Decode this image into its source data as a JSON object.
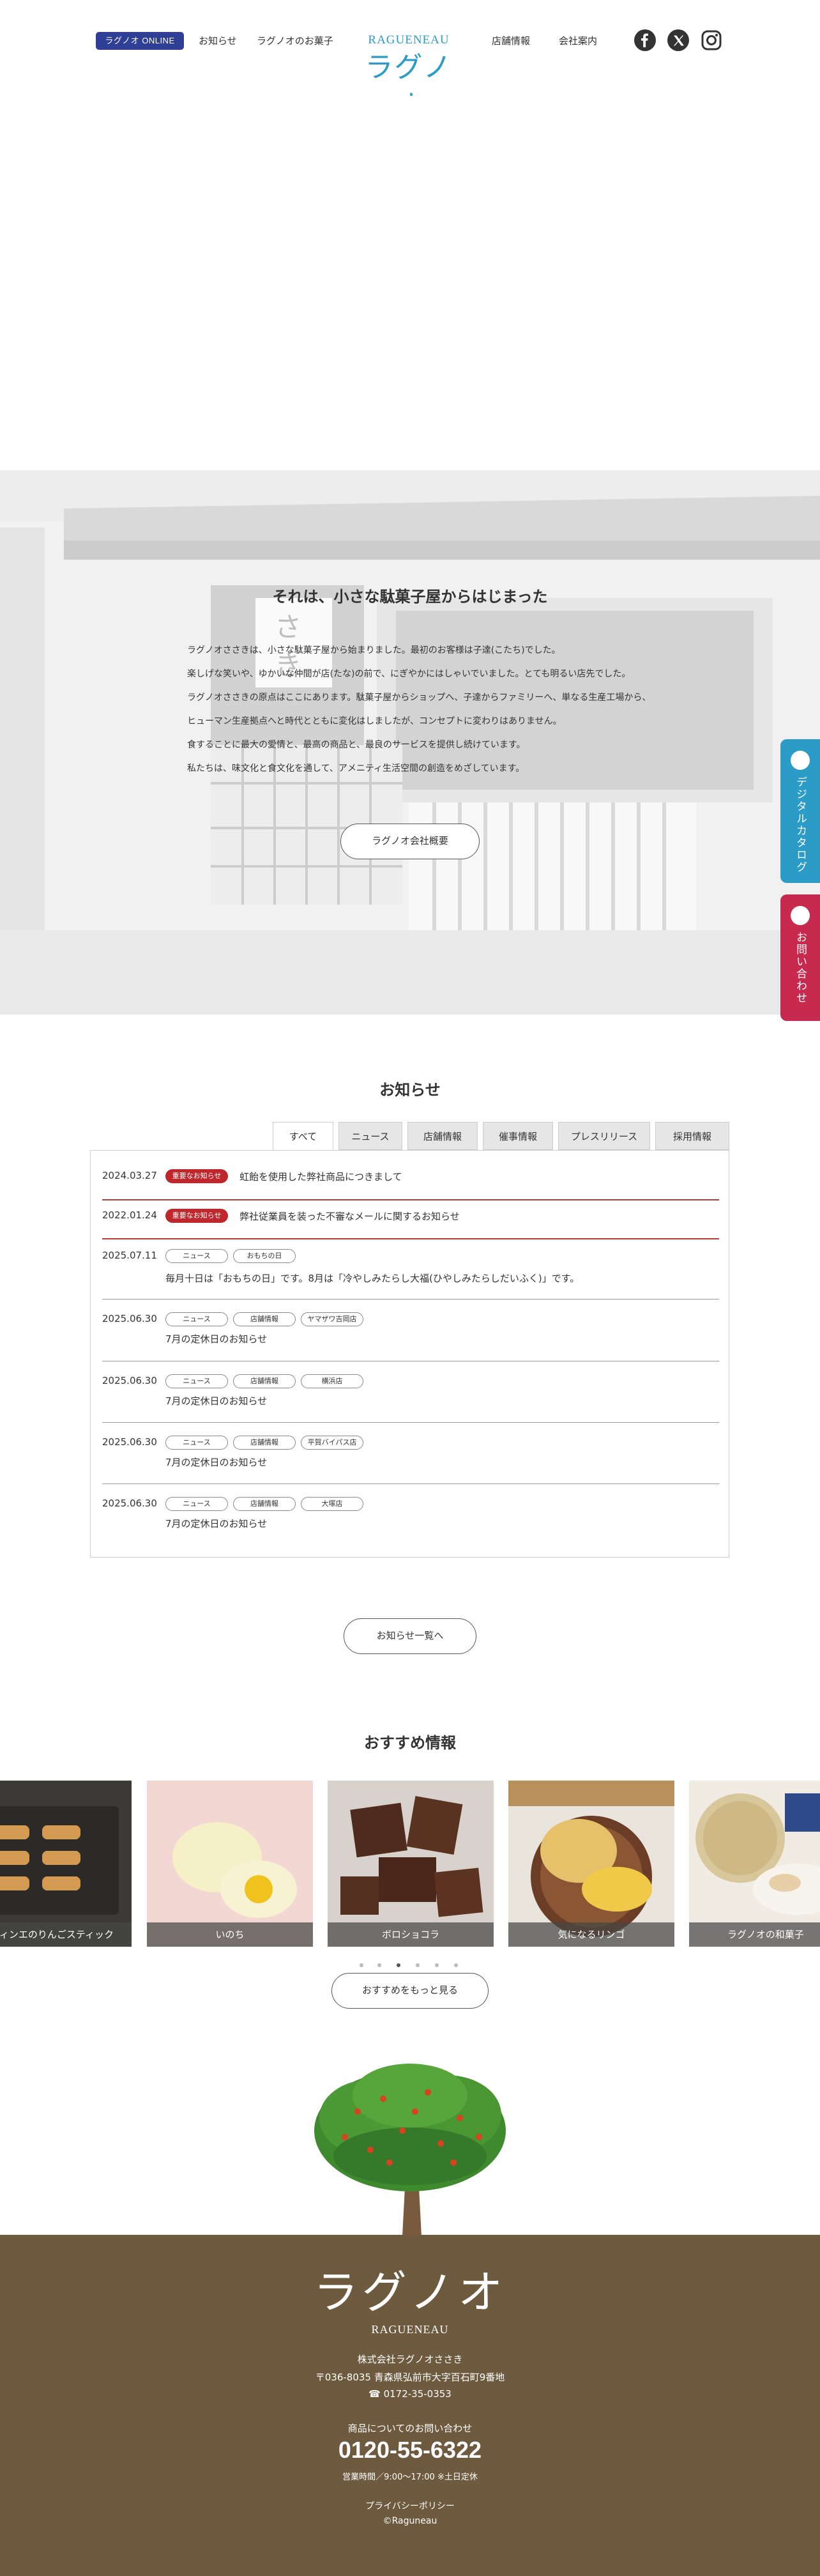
{
  "header": {
    "online_shop": "ラグノオ ONLINE SHOP",
    "nav": [
      "お知らせ",
      "ラグノオのお菓子",
      "店舗情報",
      "会社案内"
    ],
    "logo_en": "RAGUENEAU",
    "logo_jp": "ラグノオ"
  },
  "story": {
    "title": "それは、小さな駄菓子屋からはじまった",
    "paragraphs": [
      "ラグノオささきは、小さな駄菓子屋から始まりました。最初のお客様は子達(こたち)でした。",
      "楽しげな笑いや、ゆかいな仲間が店(たな)の前で、にぎやかにはしゃいでいました。とても明るい店先でした。",
      "ラグノオささきの原点はここにあります。駄菓子屋からショップへ、子達からファミリーへ、単なる生産工場から、",
      "ヒューマン生産拠点へと時代とともに変化はしましたが、コンセプトに変わりはありません。",
      "食することに最大の愛情と、最高の商品と、最良のサービスを提供し続けています。",
      "私たちは、味文化と食文化を通して、アメニティ生活空間の創造をめざしています。"
    ],
    "button": "ラグノオ会社概要"
  },
  "side_tabs": {
    "catalog": "デジタルカタログ",
    "contact": "お問い合わせ"
  },
  "news": {
    "title": "お知らせ",
    "tabs": [
      "すべて",
      "ニュース",
      "店舗情報",
      "催事情報",
      "プレスリリース",
      "採用情報"
    ],
    "items": [
      {
        "date": "2024.03.27",
        "tags": [
          "重要なお知らせ"
        ],
        "title": "虹飴を使用した弊社商品につきまして"
      },
      {
        "date": "2022.01.24",
        "tags": [
          "重要なお知らせ"
        ],
        "title": "弊社従業員を装った不審なメールに関するお知らせ"
      },
      {
        "date": "2025.07.11",
        "tags": [
          "ニュース",
          "おもちの日"
        ],
        "title": "毎月十日は「おもちの日」です。8月は「冷やしみたらし大福(ひやしみたらしだいふく)」です。"
      },
      {
        "date": "2025.06.30",
        "tags": [
          "ニュース",
          "店舗情報",
          "ヤマザワ吉岡店"
        ],
        "title": "7月の定休日のお知らせ"
      },
      {
        "date": "2025.06.30",
        "tags": [
          "ニュース",
          "店舗情報",
          "横浜店"
        ],
        "title": "7月の定休日のお知らせ"
      },
      {
        "date": "2025.06.30",
        "tags": [
          "ニュース",
          "店舗情報",
          "平賀バイパス店"
        ],
        "title": "7月の定休日のお知らせ"
      },
      {
        "date": "2025.06.30",
        "tags": [
          "ニュース",
          "店舗情報",
          "大塚店"
        ],
        "title": "7月の定休日のお知らせ"
      }
    ],
    "more_button": "お知らせ一覧へ"
  },
  "recommend": {
    "title": "おすすめ情報",
    "items": [
      "ティンエのりんごスティック",
      "いのち",
      "ボロショコラ",
      "気になるリンゴ",
      "ラグノオの和菓子"
    ],
    "more_button": "おすすめをもっと見る"
  },
  "footer": {
    "logo_jp": "ラグノオ",
    "logo_en": "RAGUENEAU",
    "company": "株式会社ラグノオささき",
    "address": "〒036-8035 青森県弘前市大字百石町9番地",
    "tel": "☎ 0172-35-0353",
    "inquiry_label": "商品についてのお問い合わせ",
    "free_dial": "0120-55-6322",
    "hours": "営業時間／9:00〜17:00 ※土日定休",
    "privacy": "プライバシーポリシー",
    "copyright": "©Raguneau"
  },
  "colors": {
    "brand_blue": "#2a9cc7",
    "online_badge": "#2f3f95",
    "important_red": "#c0272d",
    "catalog_tab": "#2a9cc7",
    "contact_tab": "#c8294f",
    "footer_brown": "#6e5a3e"
  }
}
